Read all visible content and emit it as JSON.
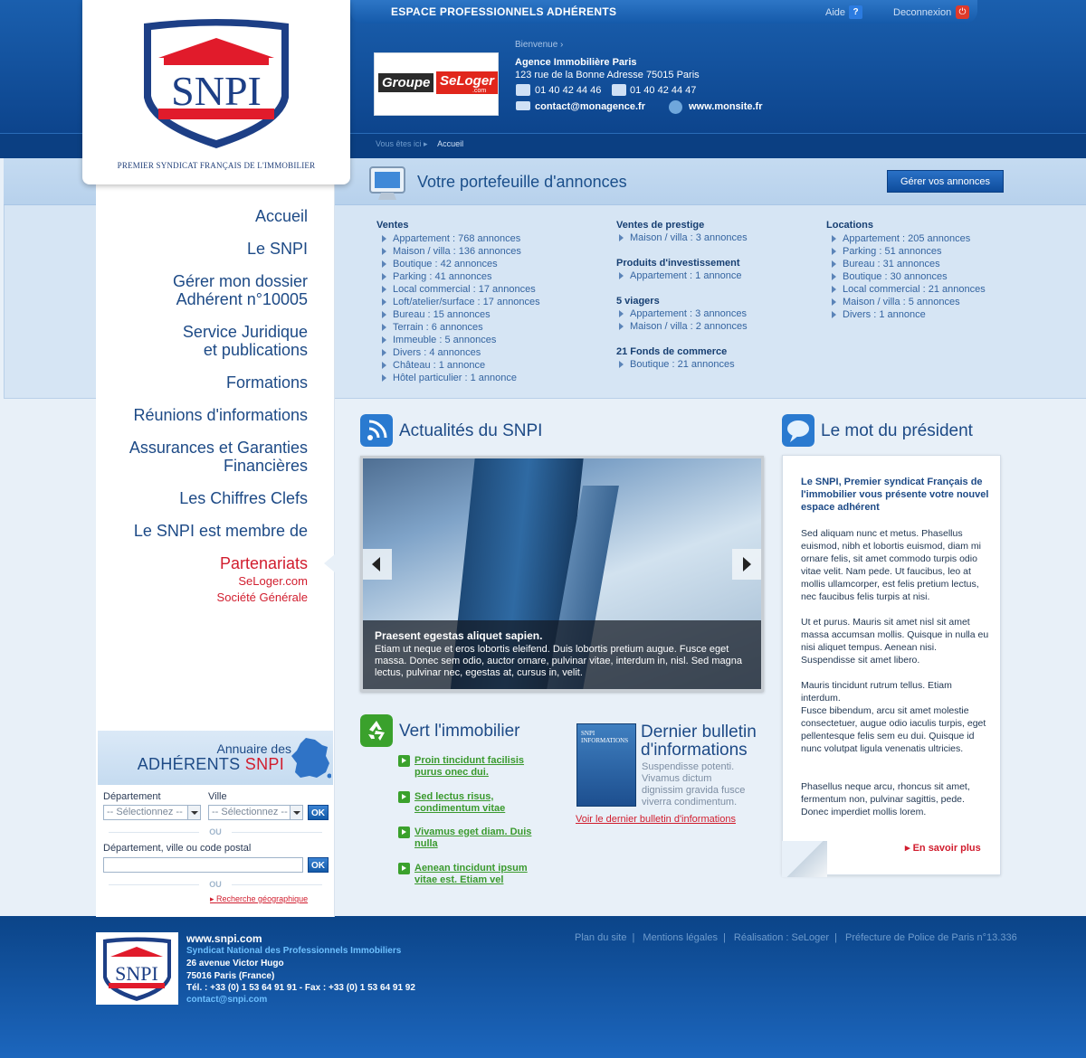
{
  "header": {
    "espace_title": "ESPACE PROFESSIONNELS ADHÉRENTS",
    "aide_label": "Aide",
    "aide_icon": "?",
    "deconnexion_label": "Deconnexion",
    "deconnexion_icon": "⏻",
    "bienvenue": "Bienvenue",
    "agence_name": "Agence Immobilière Paris",
    "agence_address": "123 rue de la Bonne Adresse 75015 Paris",
    "phone": "01 40 42 44 46",
    "fax": "01 40 42 44 47",
    "email": "contact@monagence.fr",
    "website": "www.monsite.fr",
    "partner_logo": {
      "word1": "Groupe",
      "word2": "SeLoger",
      "word3": ".com"
    }
  },
  "logo": {
    "brand": "SNPI",
    "tagline": "PREMIER SYNDICAT FRANÇAIS DE L'IMMOBILIER"
  },
  "breadcrumb": {
    "prefix": "Vous êtes ici",
    "current": "Accueil"
  },
  "nav": {
    "items": [
      {
        "label": "Accueil"
      },
      {
        "label": "Le SNPI"
      },
      {
        "line1": "Gérer mon dossier",
        "line2": "Adhérent n°10005"
      },
      {
        "line1": "Service Juridique",
        "line2": "et publications"
      },
      {
        "label": "Formations"
      },
      {
        "label": "Réunions d'informations"
      },
      {
        "line1": "Assurances et Garanties",
        "line2": "Financières"
      },
      {
        "label": "Les Chiffres Clefs"
      },
      {
        "label": "Le SNPI est membre de"
      },
      {
        "label": "Partenariats"
      }
    ],
    "partenariats_sub": [
      "SeLoger.com",
      "Société Générale"
    ]
  },
  "portfolio": {
    "title": "Votre portefeuille d'annonces",
    "manage_button": "Gérer vos annonces",
    "ventes": {
      "title": "Ventes",
      "items": [
        "Appartement : 768 annonces",
        "Maison / villa : 136 annonces",
        "Boutique : 42 annonces",
        "Parking : 41 annonces",
        "Local commercial : 17 annonces",
        "Loft/atelier/surface : 17 annonces",
        "Bureau : 15 annonces",
        "Terrain : 6 annonces",
        "Immeuble : 5 annonces",
        "Divers : 4 annonces",
        "Château : 1 annonce",
        "Hôtel particulier : 1 annonce"
      ]
    },
    "prestige": {
      "title": "Ventes de prestige",
      "items": [
        "Maison / villa : 3 annonces"
      ]
    },
    "investissement": {
      "title": "Produits d'investissement",
      "items": [
        "Appartement : 1 annonce"
      ]
    },
    "viagers": {
      "title": "5 viagers",
      "items": [
        "Appartement : 3 annonces",
        "Maison / villa : 2 annonces"
      ]
    },
    "fonds": {
      "title": "21 Fonds de commerce",
      "items": [
        "Boutique : 21 annonces"
      ]
    },
    "locations": {
      "title": "Locations",
      "items": [
        "Appartement : 205 annonces",
        "Parking : 51 annonces",
        "Bureau : 31 annonces",
        "Boutique : 30 annonces",
        "Local commercial : 21 annonces",
        "Maison / villa : 5 annonces",
        "Divers : 1 annonce"
      ]
    }
  },
  "actualites": {
    "title": "Actualités du SNPI",
    "slide_title": "Praesent egestas aliquet sapien.",
    "slide_text": "Etiam ut neque et eros lobortis eleifend. Duis lobortis pretium augue. Fusce eget massa. Donec sem odio, auctor ornare, pulvinar vitae, interdum in, nisl. Sed magna lectus, pulvinar nec, egestas at, cursus in, velit."
  },
  "president": {
    "title": "Le mot du président",
    "lead": "Le SNPI, Premier syndicat Français de l'immobilier vous présente votre nouvel espace adhérent",
    "p1": "Sed aliquam nunc et metus. Phasellus euismod, nibh et lobortis euismod, diam mi ornare felis, sit amet commodo turpis odio vitae velit. Nam pede. Ut faucibus, leo at mollis ullamcorper, est felis pretium lectus, nec faucibus felis turpis at nisi.",
    "p2": "Ut et purus. Mauris sit amet nisl sit amet massa accumsan mollis. Quisque in nulla eu nisi aliquet tempus. Aenean nisi. Suspendisse sit amet libero.",
    "p3": "Mauris tincidunt rutrum tellus. Etiam interdum.",
    "p4": "Fusce bibendum, arcu sit amet molestie consectetuer, augue odio iaculis turpis, eget pellentesque felis sem eu dui. Quisque id nunc volutpat ligula venenatis ultricies.",
    "p5": "Phasellus neque arcu, rhoncus sit amet, fermentum non, pulvinar sagittis, pede. Donec imperdiet mollis lorem.",
    "more": "En savoir plus"
  },
  "vert": {
    "title": "Vert l'immobilier",
    "links": [
      {
        "line1": "Proin tincidunt facilisis",
        "line2": "purus onec dui."
      },
      {
        "line1": "Sed lectus risus,",
        "line2": "condimentum vitae"
      },
      {
        "line1": "Vivamus eget diam. Duis",
        "line2": "nulla"
      },
      {
        "line1": "Aenean tincidunt ipsum",
        "line2": "vitae est. Etiam vel"
      }
    ]
  },
  "bulletin": {
    "title_line1": "Dernier bulletin",
    "title_line2": "d'informations",
    "cover_text": "SNPI INFORMATIONS",
    "text": "Suspendisse potenti. Vivamus dictum dignissim gravida fusce viverra condimentum.",
    "link": "Voir le dernier bulletin d'informations"
  },
  "annuaire": {
    "title1": "Annuaire des",
    "title2a": "ADHÉRENTS",
    "title2b": "SNPI",
    "departement_label": "Département",
    "ville_label": "Ville",
    "select_placeholder": "-- Sélectionnez --",
    "ok": "OK",
    "ou": "OU",
    "search_label": "Département, ville ou code postal",
    "geo_link": "Recherche géographique"
  },
  "footer": {
    "www": "www.snpi.com",
    "org": "Syndicat National des Professionnels Immobiliers",
    "address1": "26 avenue Victor Hugo",
    "address2": "75016 Paris (France)",
    "tel": "Tél. : +33 (0) 1 53 64 91 91  -  Fax : +33 (0) 1 53 64 91 92",
    "email": "contact@snpi.com",
    "links": [
      "Plan du site",
      "Mentions légales",
      "Réalisation : SeLoger",
      "Préfecture de Police de Paris n°13.336"
    ]
  },
  "colors": {
    "primary_blue": "#1d4a86",
    "accent_red": "#d11d2e",
    "green": "#3aa12c"
  }
}
